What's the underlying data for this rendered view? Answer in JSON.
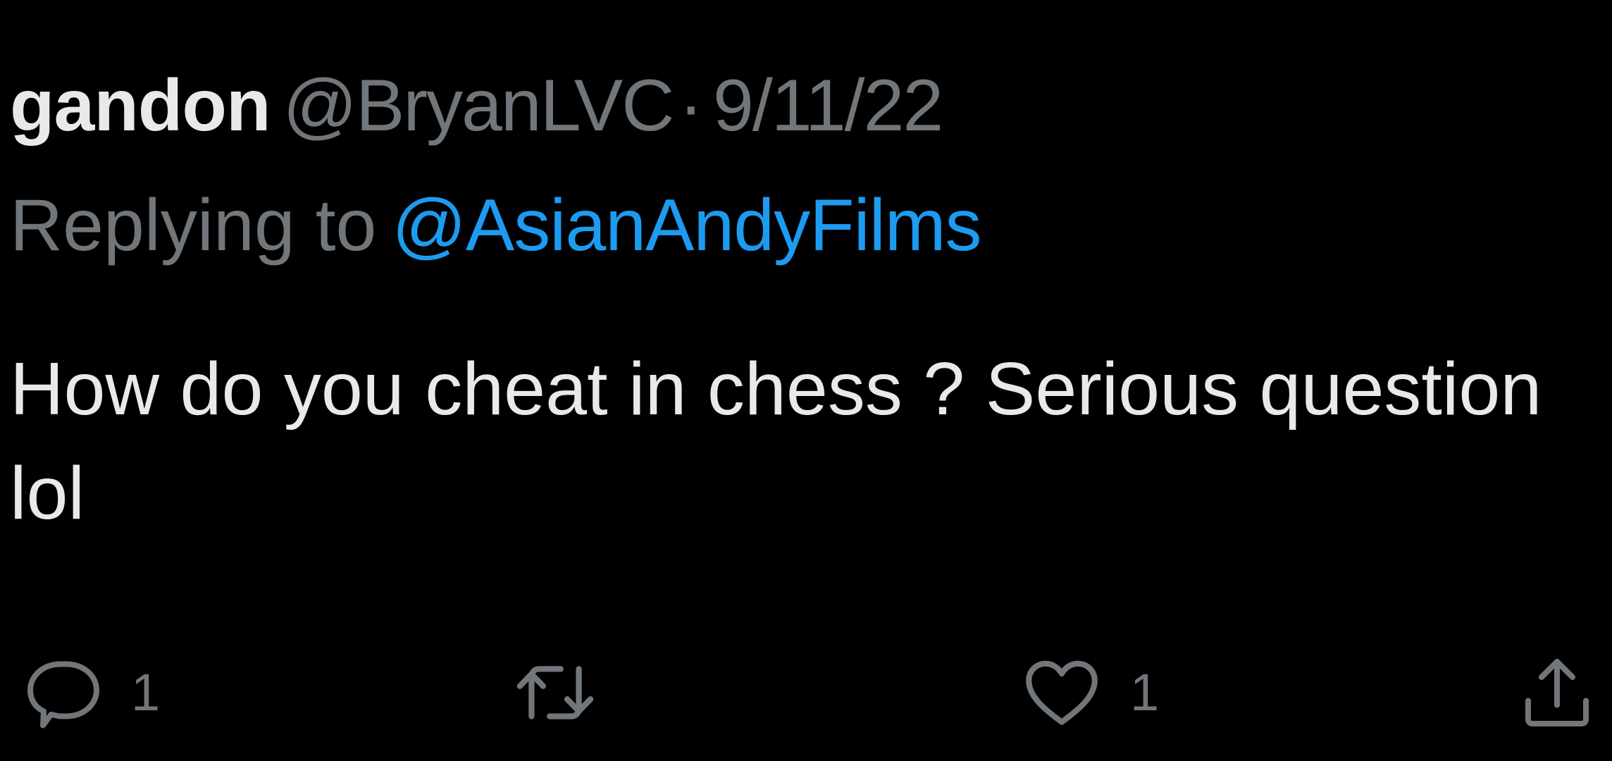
{
  "tweet": {
    "display_name": "gandon",
    "handle": "@BryanLVC",
    "separator": "·",
    "date": "9/11/22",
    "replying_prefix": "Replying to",
    "replying_handle": "@AsianAndyFilms",
    "text": "How do you cheat in chess ? Serious question lol"
  },
  "actions": {
    "reply_icon": "reply-bubble-icon",
    "reply_count": "1",
    "retweet_icon": "retweet-icon",
    "retweet_count": "",
    "like_icon": "heart-icon",
    "like_count": "1",
    "share_icon": "share-icon"
  },
  "colors": {
    "background": "#000000",
    "primary_text": "#e7e9ea",
    "secondary_text": "#71767b",
    "link": "#1d9bf0"
  }
}
